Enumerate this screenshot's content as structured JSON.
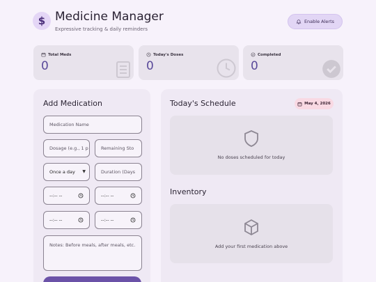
{
  "header": {
    "logo_symbol": "$",
    "title": "Medicine Manager",
    "subtitle": "Expressive tracking & daily reminders",
    "alerts_button": "Enable Alerts"
  },
  "stats": [
    {
      "label": "Total Meds",
      "value": "0",
      "icon": "pill-list-icon"
    },
    {
      "label": "Today's Doses",
      "value": "0",
      "icon": "clock-icon"
    },
    {
      "label": "Completed",
      "value": "0",
      "icon": "check-circle-icon"
    }
  ],
  "form": {
    "title": "Add Medication",
    "name_placeholder": "Medication Name",
    "dosage_placeholder": "Dosage (e.g., 1 p",
    "stock_placeholder": "Remaining Sto",
    "frequency_value": "Once a day",
    "duration_placeholder": "Duration (Days",
    "time_placeholder": "--:-- --",
    "notes_placeholder": "Notes: Before meals, after meals, etc."
  },
  "schedule": {
    "title": "Today's Schedule",
    "date": "May 4, 2026",
    "empty_text": "No doses scheduled for today"
  },
  "inventory": {
    "title": "Inventory",
    "empty_text": "Add your first medication above"
  },
  "colors": {
    "accent": "#6b52a8",
    "background": "#f7f2fb",
    "badge": "#f9d9e3"
  }
}
